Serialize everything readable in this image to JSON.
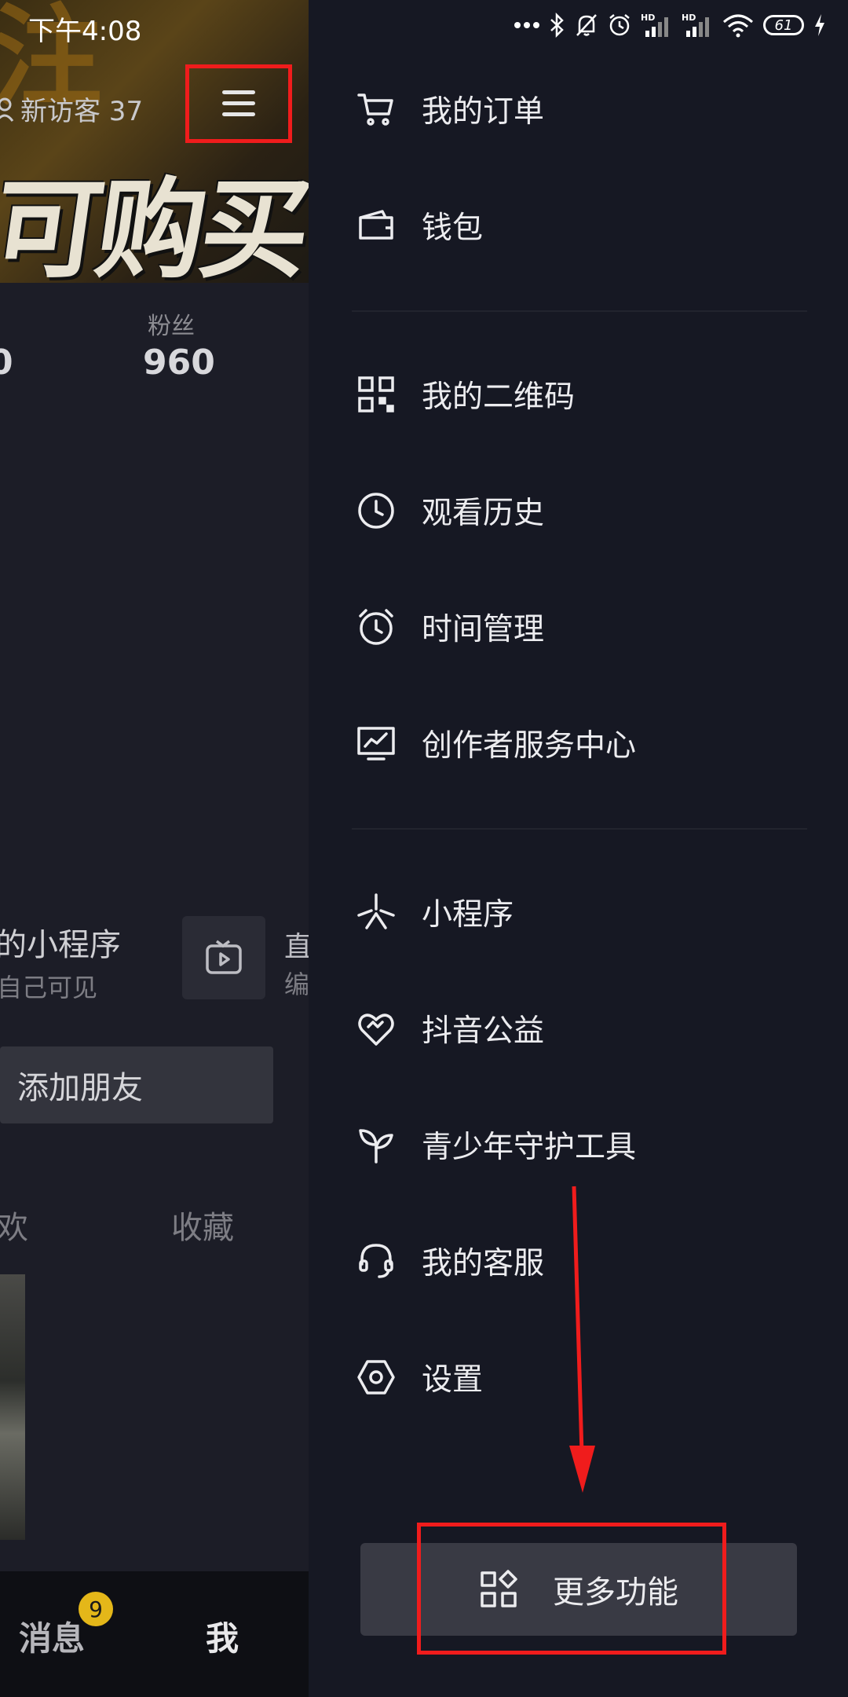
{
  "status_bar": {
    "time": "下午4:08",
    "battery": "61",
    "icons": [
      "more-dots-icon",
      "bluetooth-icon",
      "mute-bell-icon",
      "alarm-icon",
      "hd-signal-icon",
      "hd-signal-icon",
      "wifi-icon",
      "battery-icon",
      "charging-icon"
    ]
  },
  "profile": {
    "visitor_label": "新访客 37",
    "banner_text": "可购买",
    "fans_label": "粉丝",
    "fans_count": "960",
    "left_edge_number": "0",
    "mini_program_title": "的小程序",
    "mini_program_sub": "自己可见",
    "live_char_top": "直",
    "live_char_bottom": "编",
    "add_friend": "添加朋友",
    "tab_like": "欢",
    "tab_favorites": "收藏"
  },
  "bottom_nav": {
    "messages": "消息",
    "messages_badge": "9",
    "me": "我"
  },
  "drawer": {
    "groups": [
      [
        {
          "label": "我的订单",
          "icon": "cart-icon"
        },
        {
          "label": "钱包",
          "icon": "wallet-icon"
        }
      ],
      [
        {
          "label": "我的二维码",
          "icon": "qrcode-icon"
        },
        {
          "label": "观看历史",
          "icon": "clock-icon"
        },
        {
          "label": "时间管理",
          "icon": "alarm-clock-icon"
        },
        {
          "label": "创作者服务中心",
          "icon": "creator-chart-icon"
        }
      ],
      [
        {
          "label": "小程序",
          "icon": "mini-program-icon"
        },
        {
          "label": "抖音公益",
          "icon": "charity-heart-icon"
        },
        {
          "label": "青少年守护工具",
          "icon": "sprout-icon"
        },
        {
          "label": "我的客服",
          "icon": "headset-icon"
        },
        {
          "label": "设置",
          "icon": "settings-hexagon-icon"
        }
      ]
    ],
    "more_button": "更多功能"
  },
  "annotation_color": "#f01c1c"
}
